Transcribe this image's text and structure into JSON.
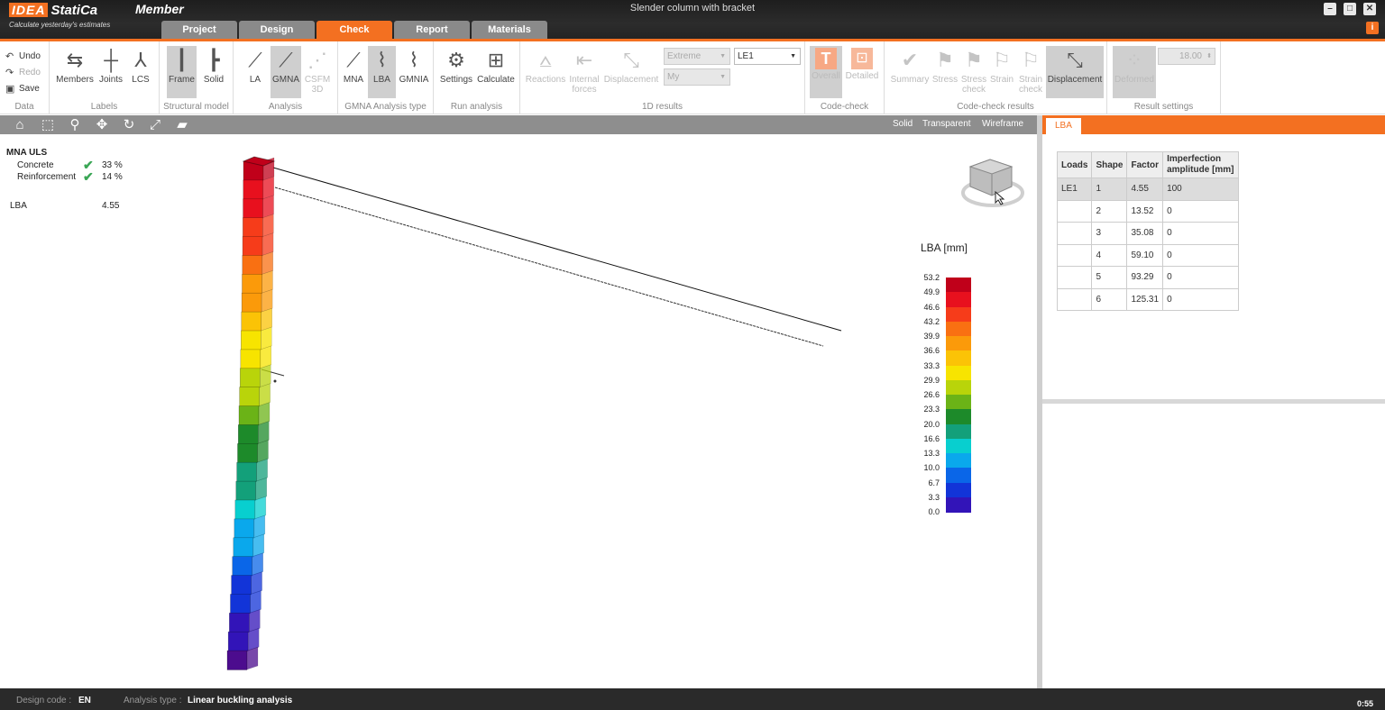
{
  "app": {
    "brand_idea": "IDEA",
    "brand_statica": "StatiCa",
    "product": "Member",
    "tagline": "Calculate yesterday's estimates",
    "window_title": "Slender column with bracket",
    "clock": "0:55"
  },
  "tabs": [
    "Project",
    "Design",
    "Check",
    "Report",
    "Materials"
  ],
  "active_tab": "Check",
  "ribbon": {
    "data": {
      "label": "Data",
      "undo": "Undo",
      "redo": "Redo",
      "save": "Save"
    },
    "labels": {
      "label": "Labels",
      "members": "Members",
      "joints": "Joints",
      "lcs": "LCS"
    },
    "structural_model": {
      "label": "Structural model",
      "frame": "Frame",
      "solid": "Solid"
    },
    "analysis": {
      "label": "Analysis",
      "la": "LA",
      "gmna": "GMNA",
      "csfm_1": "CSFM",
      "csfm_2": "3D"
    },
    "gmna_type": {
      "label": "GMNA Analysis type",
      "mna": "MNA",
      "lba": "LBA",
      "gmnia": "GMNIA"
    },
    "run_analysis": {
      "label": "Run analysis",
      "settings": "Settings",
      "calculate": "Calculate"
    },
    "results_1d": {
      "label": "1D results",
      "reactions": "Reactions",
      "internal_1": "Internal",
      "internal_2": "forces",
      "displacement": "Displacement",
      "extreme": "Extreme",
      "my": "My",
      "le": "LE1"
    },
    "code_check": {
      "label": "Code-check",
      "overall": "Overall",
      "detailed": "Detailed"
    },
    "code_check_results": {
      "label": "Code-check results",
      "summary": "Summary",
      "stress": "Stress",
      "stress_check_1": "Stress",
      "stress_check_2": "check",
      "strain": "Strain",
      "strain_check_1": "Strain",
      "strain_check_2": "check",
      "displacement": "Displacement"
    },
    "result_settings": {
      "label": "Result settings",
      "deformed": "Deformed",
      "scale": "18.00"
    }
  },
  "view_modes": [
    "Solid",
    "Transparent",
    "Wireframe"
  ],
  "results_summary": {
    "title": "MNA ULS",
    "concrete_label": "Concrete",
    "concrete_value": "33 %",
    "reinforcement_label": "Reinforcement",
    "reinforcement_value": "14 %",
    "lba_label": "LBA",
    "lba_value": "4.55"
  },
  "legend": {
    "title": "LBA [mm]",
    "values": [
      "53.2",
      "49.9",
      "46.6",
      "43.2",
      "39.9",
      "36.6",
      "33.3",
      "29.9",
      "26.6",
      "23.3",
      "20.0",
      "16.6",
      "13.3",
      "10.0",
      "6.7",
      "3.3",
      "0.0"
    ],
    "colors": [
      "#c0001a",
      "#e8101e",
      "#f63c1a",
      "#f97012",
      "#fb9a0a",
      "#fbc306",
      "#f7e400",
      "#b9d40a",
      "#6bb317",
      "#1d8a2a",
      "#13a07a",
      "#08cfcf",
      "#0aa8ec",
      "#0a66e8",
      "#1234d8",
      "#3214b8",
      "#4c0c8e"
    ]
  },
  "panel": {
    "tab": "LBA",
    "columns": [
      "Loads",
      "Shape",
      "Factor",
      "Imperfection amplitude [mm]"
    ],
    "rows": [
      [
        "LE1",
        "1",
        "4.55",
        "100"
      ],
      [
        "",
        "2",
        "13.52",
        "0"
      ],
      [
        "",
        "3",
        "35.08",
        "0"
      ],
      [
        "",
        "4",
        "59.10",
        "0"
      ],
      [
        "",
        "5",
        "93.29",
        "0"
      ],
      [
        "",
        "6",
        "125.31",
        "0"
      ]
    ]
  },
  "status": {
    "design_code_label": "Design code :",
    "design_code_value": "EN",
    "analysis_type_label": "Analysis type :",
    "analysis_type_value": "Linear buckling analysis"
  },
  "colors": {
    "accent": "#f37021",
    "title_bar": "#262626",
    "tab_inactive": "#8a8a8a",
    "check_green": "#3aa655"
  }
}
